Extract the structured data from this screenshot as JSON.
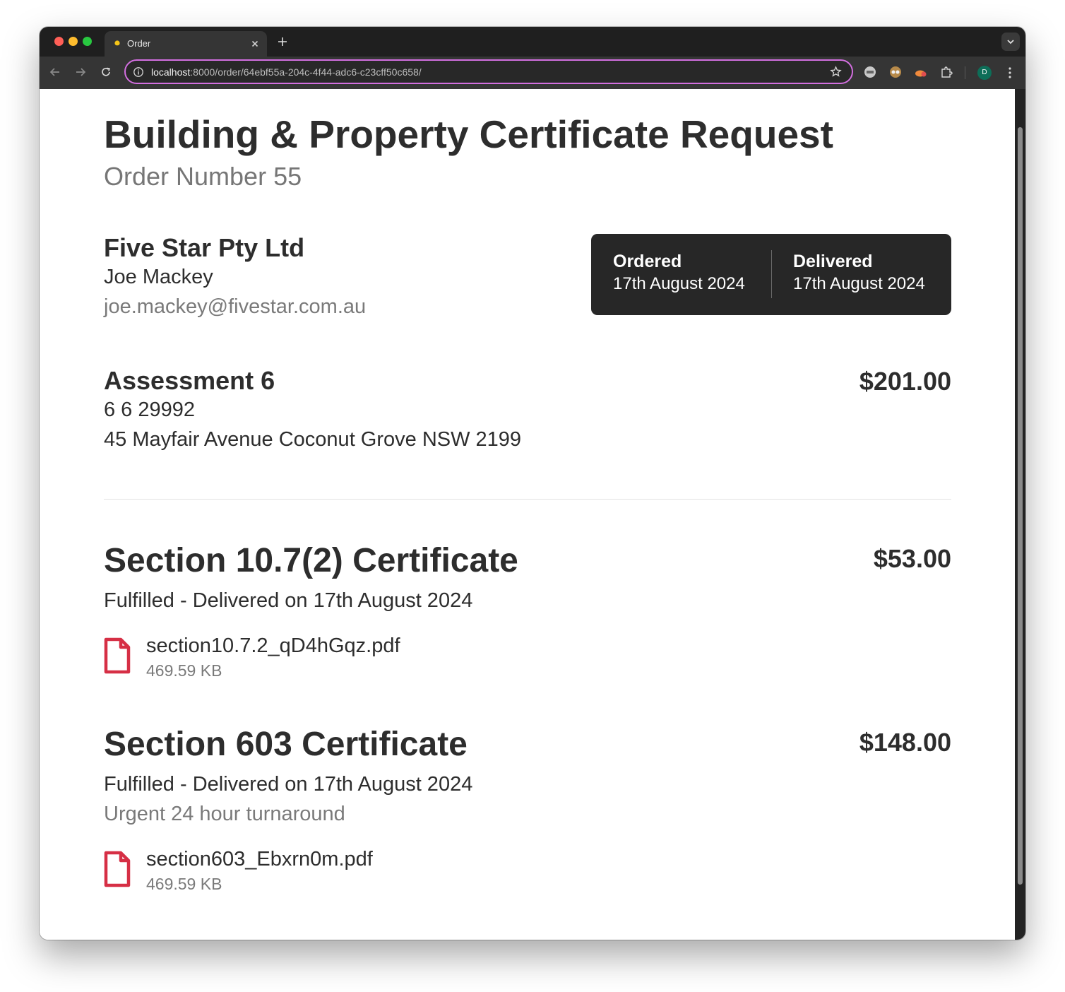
{
  "browser": {
    "tab_title": "Order",
    "url_host": "localhost",
    "url_rest": ":8000/order/64ebf55a-204c-4f44-adc6-c23cff50c658/",
    "profile_initial": "D",
    "accent_color": "#d36fe0"
  },
  "page": {
    "title": "Building & Property Certificate Request",
    "subtitle": "Order Number 55"
  },
  "customer": {
    "company": "Five Star Pty Ltd",
    "contact_name": "Joe Mackey",
    "email": "joe.mackey@fivestar.com.au"
  },
  "dates": {
    "ordered_label": "Ordered",
    "ordered_value": "17th August 2024",
    "delivered_label": "Delivered",
    "delivered_value": "17th August 2024"
  },
  "assessment": {
    "title": "Assessment 6",
    "number": "6 6 29992",
    "address": "45 Mayfair Avenue Coconut Grove NSW 2199",
    "price": "$201.00"
  },
  "certificates": [
    {
      "title": "Section 10.7(2) Certificate",
      "price": "$53.00",
      "status": "Fulfilled - Delivered on 17th August 2024",
      "note": "",
      "file_name": "section10.7.2_qD4hGqz.pdf",
      "file_size": "469.59 KB"
    },
    {
      "title": "Section 603 Certificate",
      "price": "$148.00",
      "status": "Fulfilled - Delivered on 17th August 2024",
      "note": "Urgent 24 hour turnaround",
      "file_name": "section603_Ebxrn0m.pdf",
      "file_size": "469.59 KB"
    }
  ],
  "icons": {
    "file": "pdf-file-icon",
    "file_color": "#d62f45"
  }
}
